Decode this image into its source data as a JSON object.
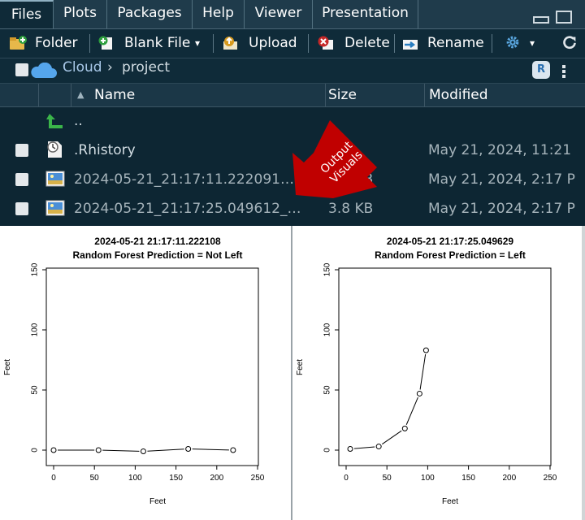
{
  "tabs": [
    {
      "label": "Files",
      "active": true
    },
    {
      "label": "Plots"
    },
    {
      "label": "Packages"
    },
    {
      "label": "Help"
    },
    {
      "label": "Viewer"
    },
    {
      "label": "Presentation"
    }
  ],
  "toolbar": {
    "folder": "Folder",
    "blank_file": "Blank File",
    "upload": "Upload",
    "delete": "Delete",
    "rename": "Rename"
  },
  "breadcrumb": {
    "root": "Cloud",
    "folder": "project"
  },
  "columns": {
    "name": "Name",
    "size": "Size",
    "modified": "Modified"
  },
  "files": [
    {
      "name": "..",
      "size": "",
      "modified": "",
      "icon": "up-arrow-icon"
    },
    {
      "name": ".Rhistory",
      "size": "",
      "modified": "May 21, 2024, 11:21",
      "icon": "history-file-icon"
    },
    {
      "name": "2024-05-21_21:17:11.222091…",
      "size": "3.6 KB",
      "modified": "May 21, 2024, 2:17 P",
      "icon": "image-file-icon"
    },
    {
      "name": "2024-05-21_21:17:25.049612_…",
      "size": "3.8 KB",
      "modified": "May 21, 2024, 2:17 P",
      "icon": "image-file-icon"
    }
  ],
  "annotation": {
    "line1": "Output",
    "line2": "Visuals",
    "color": "#c00000"
  },
  "chart_data": [
    {
      "type": "line",
      "title": "2024-05-21 21:17:11.222108",
      "subtitle": "Random Forest Prediction = Not Left",
      "xlabel": "Feet",
      "ylabel": "Feet",
      "xlim": [
        0,
        250
      ],
      "ylim": [
        0,
        150
      ],
      "xticks": [
        0,
        50,
        100,
        150,
        200,
        250
      ],
      "yticks": [
        0,
        50,
        100,
        150
      ],
      "x": [
        0,
        55,
        110,
        165,
        220
      ],
      "y": [
        0,
        0,
        -1,
        1,
        0
      ]
    },
    {
      "type": "line",
      "title": "2024-05-21 21:17:25.049629",
      "subtitle": "Random Forest Prediction = Left",
      "xlabel": "Feet",
      "ylabel": "Feet",
      "xlim": [
        0,
        250
      ],
      "ylim": [
        0,
        150
      ],
      "xticks": [
        0,
        50,
        100,
        150,
        200,
        250
      ],
      "yticks": [
        0,
        50,
        100,
        150
      ],
      "x": [
        5,
        40,
        72,
        90,
        98
      ],
      "y": [
        1,
        3,
        18,
        47,
        83
      ]
    }
  ],
  "colors": {
    "pane_bg": "#0d2633",
    "tab_bg": "#1f3b4b",
    "header_bg": "#1b3747",
    "link": "#a8c8e8",
    "muted": "#a6b4bb"
  }
}
